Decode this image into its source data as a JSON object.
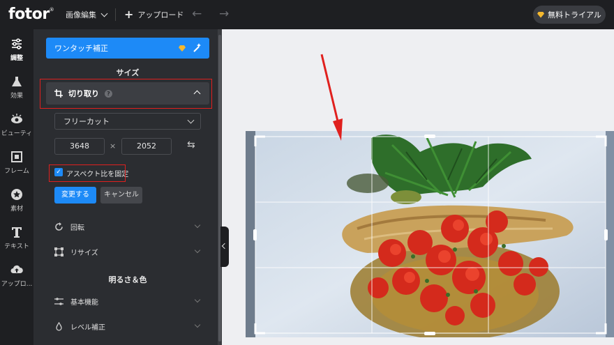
{
  "topbar": {
    "logo": "fotor",
    "logo_mark": "®",
    "edit_menu": "画像編集",
    "upload": "アップロード",
    "trial_button": "無料トライアル"
  },
  "rail": {
    "items": [
      {
        "label": "調整",
        "icon": "sliders-icon",
        "active": true
      },
      {
        "label": "効果",
        "icon": "flask-icon"
      },
      {
        "label": "ビューティ",
        "icon": "eye-icon"
      },
      {
        "label": "フレーム",
        "icon": "frame-icon"
      },
      {
        "label": "素材",
        "icon": "star-icon"
      },
      {
        "label": "テキスト",
        "icon": "text-icon"
      },
      {
        "label": "アップロ...",
        "icon": "cloud-upload-icon"
      }
    ]
  },
  "panel": {
    "one_touch": "ワンタッチ補正",
    "size_heading": "サイズ",
    "crop": {
      "title": "切り取り",
      "help": "?",
      "ratio_option": "フリーカット",
      "width": "3648",
      "height": "2052",
      "times": "×",
      "lock_aspect": "アスペクト比を固定",
      "apply": "変更する",
      "cancel": "キャンセル"
    },
    "rotate": "回転",
    "resize": "リサイズ",
    "light_heading": "明るさ＆色",
    "basic": "基本機能",
    "levels": "レベル補正"
  },
  "colors": {
    "accent": "#1d8af7",
    "highlight": "#e0201e",
    "premium": "#f5b82e"
  }
}
